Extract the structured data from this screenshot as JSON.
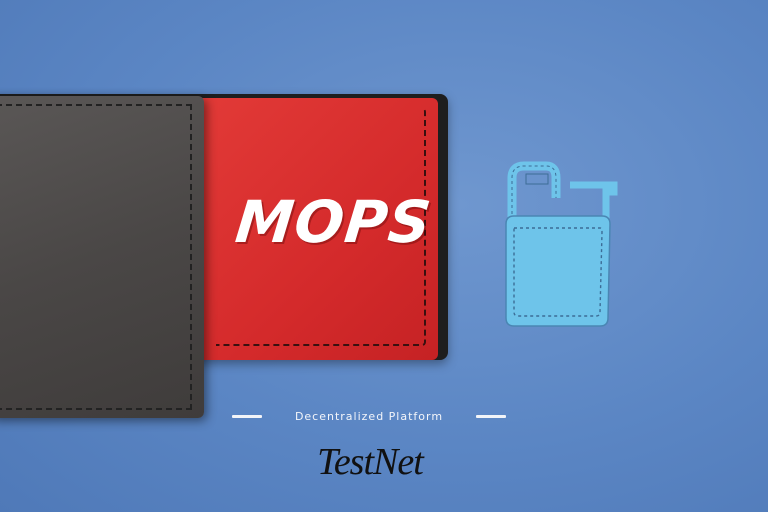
{
  "brand": {
    "name": "MOPS"
  },
  "tagline": "Decentralized Platform",
  "network": "TestNet",
  "icons": {
    "wallet": "wallet-icon",
    "lock": "padlock-icon"
  },
  "colors": {
    "background": "#5b86c4",
    "wallet_red": "#d42a2b",
    "wallet_dark": "#4a4746",
    "lock_blue": "#6ec4ea",
    "text_light": "#f3f5fa",
    "text_dark": "#111111"
  }
}
